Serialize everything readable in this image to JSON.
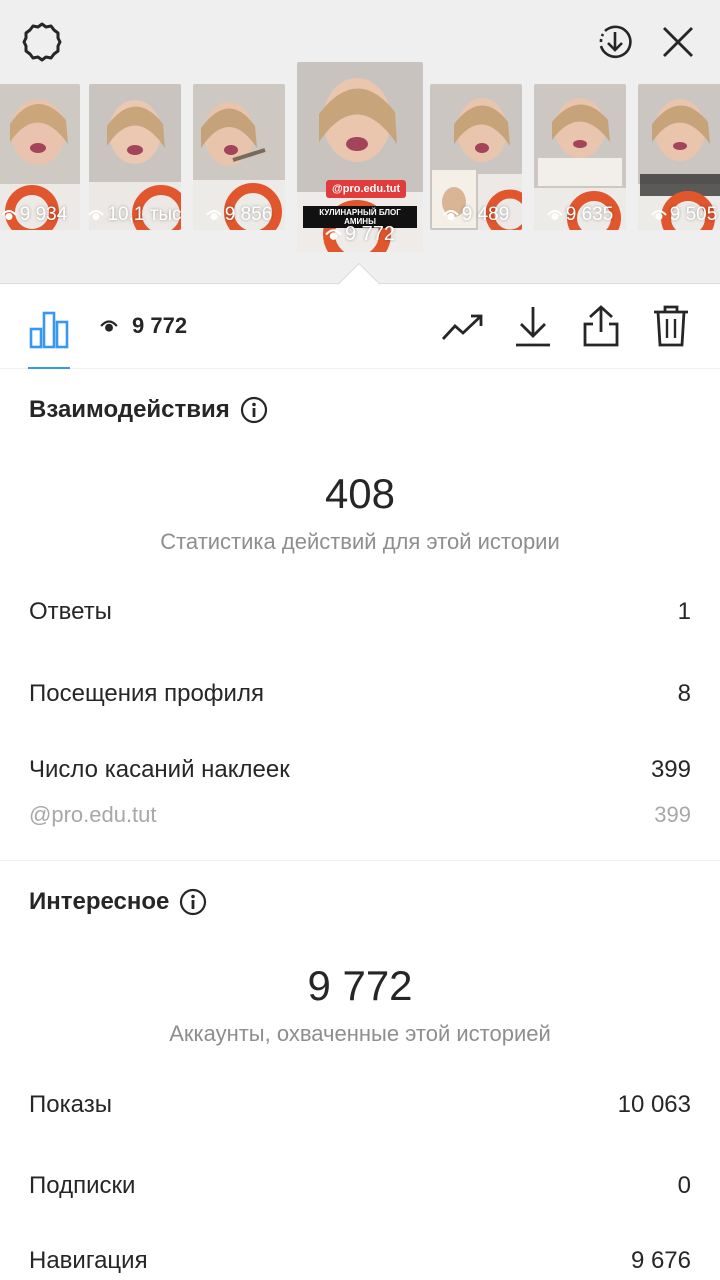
{
  "header": {
    "icons": [
      "gear-icon",
      "download-circle-icon",
      "close-icon"
    ]
  },
  "thumbnails": [
    {
      "count": "9 934",
      "active": false
    },
    {
      "count": "10,1 тыс",
      "active": false
    },
    {
      "count": "9 856",
      "active": false
    },
    {
      "count": "9 772",
      "active": true,
      "mention": "@pro.edu.tut",
      "title": "КУЛИНАРНЫЙ БЛОГ АМИНЫ"
    },
    {
      "count": "9 489",
      "active": false
    },
    {
      "count": "9 635",
      "active": false
    },
    {
      "count": "9 505",
      "active": false
    }
  ],
  "toolbar": {
    "views": "9 772",
    "icons": [
      "bar-chart-icon",
      "eye-icon",
      "trend-icon",
      "download-icon",
      "share-icon",
      "trash-icon"
    ],
    "accent": "#3897f0"
  },
  "interactions": {
    "title": "Взаимодействия",
    "total": "408",
    "caption": "Статистика действий для этой истории",
    "rows": [
      {
        "label": "Ответы",
        "value": "1"
      },
      {
        "label": "Посещения профиля",
        "value": "8"
      },
      {
        "label": "Число касаний наклеек",
        "value": "399"
      },
      {
        "label": "@pro.edu.tut",
        "value": "399"
      }
    ]
  },
  "discovery": {
    "title": "Интересное",
    "total": "9 772",
    "caption": "Аккаунты, охваченные этой историей",
    "rows": [
      {
        "label": "Показы",
        "value": "10 063"
      },
      {
        "label": "Подписки",
        "value": "0"
      },
      {
        "label": "Навигация",
        "value": "9 676"
      }
    ]
  }
}
